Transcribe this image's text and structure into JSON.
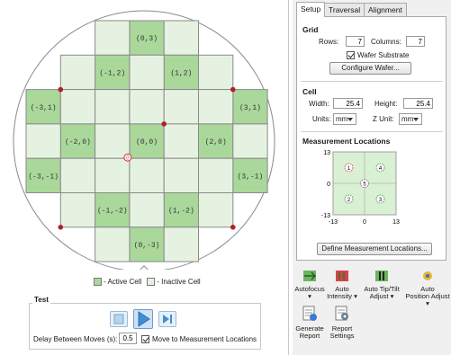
{
  "wafer": {
    "cells": [
      {
        "label": "(0,3)",
        "active": true,
        "c": 3,
        "r": 0
      },
      {
        "label": "",
        "active": false,
        "c": 2,
        "r": 0
      },
      {
        "label": "",
        "active": false,
        "c": 4,
        "r": 0
      },
      {
        "label": "(-1,2)",
        "active": true,
        "c": 2,
        "r": 1
      },
      {
        "label": "(1,2)",
        "active": true,
        "c": 4,
        "r": 1
      },
      {
        "label": "",
        "active": false,
        "c": 1,
        "r": 1
      },
      {
        "label": "",
        "active": false,
        "c": 3,
        "r": 1
      },
      {
        "label": "",
        "active": false,
        "c": 5,
        "r": 1
      },
      {
        "label": "(-3,1)",
        "active": true,
        "c": 0,
        "r": 2
      },
      {
        "label": "(3,1)",
        "active": true,
        "c": 6,
        "r": 2
      },
      {
        "label": "",
        "active": false,
        "c": 1,
        "r": 2
      },
      {
        "label": "",
        "active": false,
        "c": 2,
        "r": 2
      },
      {
        "label": "",
        "active": false,
        "c": 3,
        "r": 2
      },
      {
        "label": "",
        "active": false,
        "c": 4,
        "r": 2
      },
      {
        "label": "",
        "active": false,
        "c": 5,
        "r": 2
      },
      {
        "label": "(-2,0)",
        "active": true,
        "c": 1,
        "r": 3
      },
      {
        "label": "(0,0)",
        "active": true,
        "c": 3,
        "r": 3
      },
      {
        "label": "(2,0)",
        "active": true,
        "c": 5,
        "r": 3
      },
      {
        "label": "",
        "active": false,
        "c": 0,
        "r": 3
      },
      {
        "label": "",
        "active": false,
        "c": 2,
        "r": 3
      },
      {
        "label": "",
        "active": false,
        "c": 4,
        "r": 3
      },
      {
        "label": "",
        "active": false,
        "c": 6,
        "r": 3
      },
      {
        "label": "(-3,-1)",
        "active": true,
        "c": 0,
        "r": 4
      },
      {
        "label": "(3,-1)",
        "active": true,
        "c": 6,
        "r": 4
      },
      {
        "label": "",
        "active": false,
        "c": 1,
        "r": 4
      },
      {
        "label": "",
        "active": false,
        "c": 2,
        "r": 4
      },
      {
        "label": "",
        "active": false,
        "c": 3,
        "r": 4
      },
      {
        "label": "",
        "active": false,
        "c": 4,
        "r": 4
      },
      {
        "label": "",
        "active": false,
        "c": 5,
        "r": 4
      },
      {
        "label": "(-1,-2)",
        "active": true,
        "c": 2,
        "r": 5
      },
      {
        "label": "(1,-2)",
        "active": true,
        "c": 4,
        "r": 5
      },
      {
        "label": "",
        "active": false,
        "c": 1,
        "r": 5
      },
      {
        "label": "",
        "active": false,
        "c": 3,
        "r": 5
      },
      {
        "label": "",
        "active": false,
        "c": 5,
        "r": 5
      },
      {
        "label": "(0,-3)",
        "active": true,
        "c": 3,
        "r": 6
      },
      {
        "label": "",
        "active": false,
        "c": 2,
        "r": 6
      },
      {
        "label": "",
        "active": false,
        "c": 4,
        "r": 6
      }
    ],
    "origin_marker": "0",
    "colors": {
      "active": "#a9d89a",
      "inactive": "#e6f2e1",
      "border": "#8a8a8a",
      "marker": "#b0202a",
      "origin": "#d43030"
    }
  },
  "legend": {
    "active_label": "- Active Cell",
    "inactive_label": "- Inactive Cell"
  },
  "test": {
    "title": "Test",
    "delay_label": "Delay Between Moves (s):",
    "delay_value": "0.5",
    "move_checkbox_checked": true,
    "move_label": "Move to Measurement Locations"
  },
  "tabs": [
    {
      "label": "Setup",
      "active": true
    },
    {
      "label": "Traversal",
      "active": false
    },
    {
      "label": "Alignment",
      "active": false
    }
  ],
  "grid": {
    "title": "Grid",
    "rows_label": "Rows:",
    "rows_value": "7",
    "columns_label": "Columns:",
    "columns_value": "7",
    "wafer_substrate_label": "Wafer Substrate",
    "wafer_substrate_checked": true,
    "configure_button": "Configure Wafer..."
  },
  "cell": {
    "title": "Cell",
    "width_label": "Width:",
    "width_value": "25.4",
    "height_label": "Height:",
    "height_value": "25.4",
    "units_label": "Units:",
    "units_value": "mm",
    "zunit_label": "Z Unit:",
    "zunit_value": "mm"
  },
  "measurement": {
    "title": "Measurement Locations",
    "y_ticks": [
      "13",
      "0",
      "-13"
    ],
    "x_ticks": [
      "-13",
      "0",
      "13"
    ],
    "points": [
      {
        "label": "1",
        "x": -6.5,
        "y": 6.5
      },
      {
        "label": "4",
        "x": 6.5,
        "y": 6.5
      },
      {
        "label": "5",
        "x": 0,
        "y": 0
      },
      {
        "label": "2",
        "x": -6.5,
        "y": -6.5
      },
      {
        "label": "3",
        "x": 6.5,
        "y": -6.5
      }
    ],
    "define_button": "Define Measurement Locations..."
  },
  "toolbar": {
    "autofocus": "Autofocus",
    "auto_intensity_1": "Auto",
    "auto_intensity_2": "Intensity",
    "auto_tiptilt_1": "Auto Tip/Tilt",
    "auto_tiptilt_2": "Adjust",
    "auto_position_1": "Auto",
    "auto_position_2": "Position Adjust",
    "generate_1": "Generate",
    "generate_2": "Report",
    "report_settings_1": "Report",
    "report_settings_2": "Settings"
  }
}
